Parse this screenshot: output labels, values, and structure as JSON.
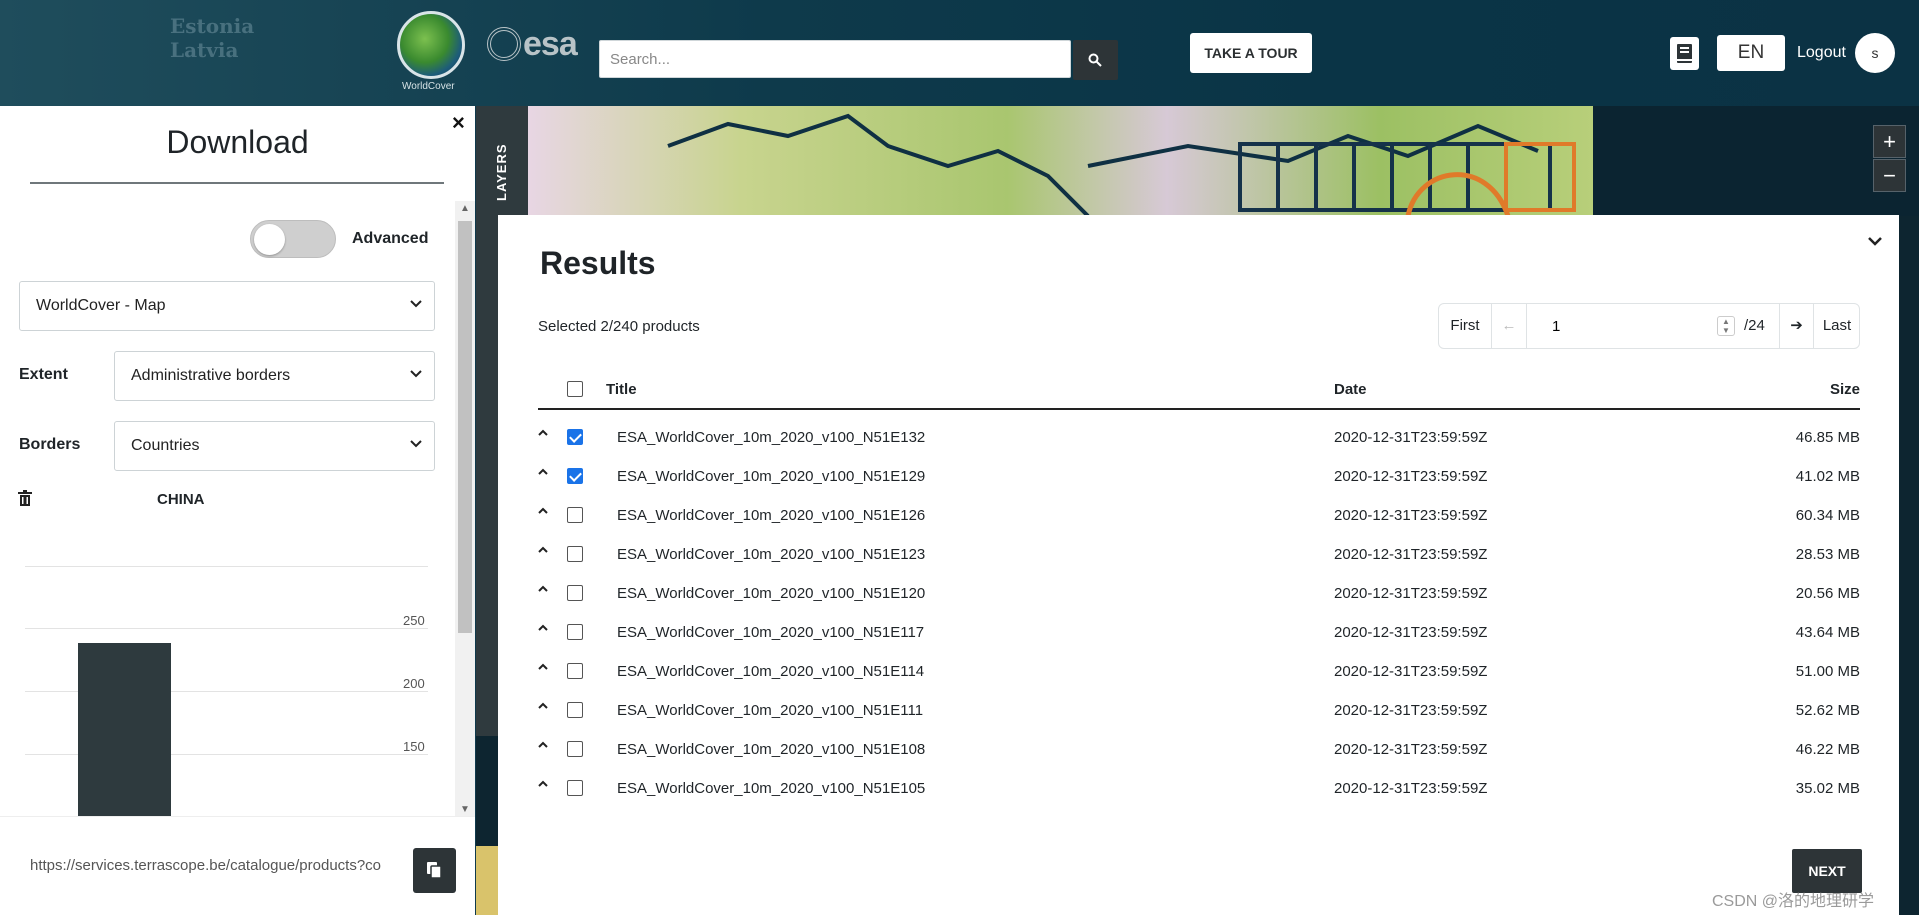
{
  "header": {
    "map_hint_text": "Estonia",
    "map_hint_text2": "Latvia",
    "worldcover_logo_text": "WorldCover",
    "esa_logo_text": "esa",
    "search_placeholder": "Search...",
    "tour_label": "TAKE A TOUR",
    "language": "EN",
    "logout_label": "Logout",
    "avatar_initial": "s"
  },
  "left_panel": {
    "title": "Download",
    "close_symbol": "×",
    "advanced_label": "Advanced",
    "advanced_on": false,
    "product_select": "WorldCover - Map",
    "extent_label": "Extent",
    "extent_value": "Administrative borders",
    "borders_label": "Borders",
    "borders_value": "Countries",
    "selected_country": "CHINA",
    "url": "https://services.terrascope.be/catalogue/products?co"
  },
  "chart_data": {
    "type": "bar",
    "categories": [
      ""
    ],
    "values": [
      238
    ],
    "yticks": [
      "250",
      "200",
      "150"
    ]
  },
  "map": {
    "layers_label": "LAYERS",
    "zoom_in": "+",
    "zoom_out": "−"
  },
  "results": {
    "title": "Results",
    "selected_text": "Selected 2/240 products",
    "pager": {
      "first": "First",
      "page": "1",
      "total": "/24",
      "last": "Last"
    },
    "columns": {
      "title": "Title",
      "date": "Date",
      "size": "Size"
    },
    "rows": [
      {
        "title": "ESA_WorldCover_10m_2020_v100_N51E132",
        "date": "2020-12-31T23:59:59Z",
        "size": "46.85 MB",
        "checked": true
      },
      {
        "title": "ESA_WorldCover_10m_2020_v100_N51E129",
        "date": "2020-12-31T23:59:59Z",
        "size": "41.02 MB",
        "checked": true
      },
      {
        "title": "ESA_WorldCover_10m_2020_v100_N51E126",
        "date": "2020-12-31T23:59:59Z",
        "size": "60.34 MB",
        "checked": false
      },
      {
        "title": "ESA_WorldCover_10m_2020_v100_N51E123",
        "date": "2020-12-31T23:59:59Z",
        "size": "28.53 MB",
        "checked": false
      },
      {
        "title": "ESA_WorldCover_10m_2020_v100_N51E120",
        "date": "2020-12-31T23:59:59Z",
        "size": "20.56 MB",
        "checked": false
      },
      {
        "title": "ESA_WorldCover_10m_2020_v100_N51E117",
        "date": "2020-12-31T23:59:59Z",
        "size": "43.64 MB",
        "checked": false
      },
      {
        "title": "ESA_WorldCover_10m_2020_v100_N51E114",
        "date": "2020-12-31T23:59:59Z",
        "size": "51.00 MB",
        "checked": false
      },
      {
        "title": "ESA_WorldCover_10m_2020_v100_N51E111",
        "date": "2020-12-31T23:59:59Z",
        "size": "52.62 MB",
        "checked": false
      },
      {
        "title": "ESA_WorldCover_10m_2020_v100_N51E108",
        "date": "2020-12-31T23:59:59Z",
        "size": "46.22 MB",
        "checked": false
      },
      {
        "title": "ESA_WorldCover_10m_2020_v100_N51E105",
        "date": "2020-12-31T23:59:59Z",
        "size": "35.02 MB",
        "checked": false
      }
    ],
    "next_label": "NEXT"
  },
  "watermark": "CSDN @洛的地理研学",
  "colors": {
    "header_bg": "#0e3a4b",
    "dark_button": "#2d3437",
    "checkbox_blue": "#1a73e8"
  }
}
